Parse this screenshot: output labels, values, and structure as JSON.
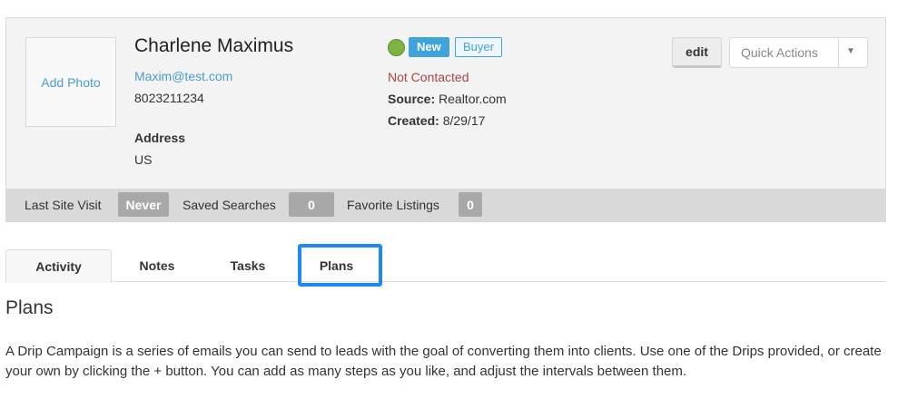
{
  "contact": {
    "photo_label": "Add Photo",
    "name": "Charlene Maximus",
    "email": "Maxim@test.com",
    "phone": "8023211234",
    "address_label": "Address",
    "address_value": "US",
    "badge_new": "New",
    "badge_buyer": "Buyer",
    "status": "Not Contacted",
    "source_label": "Source:",
    "source_value": "Realtor.com",
    "created_label": "Created:",
    "created_value": "8/29/17",
    "status_dot_icon": "green-status-dot-icon"
  },
  "actions": {
    "edit_label": "edit",
    "quick_actions_label": "Quick Actions",
    "caret_icon": "chevron-down-icon"
  },
  "stats": [
    {
      "label": "Last Site Visit",
      "value": "Never"
    },
    {
      "label": "Saved Searches",
      "value": "0"
    },
    {
      "label": "Favorite Listings",
      "value": "0"
    }
  ],
  "tabs": [
    {
      "label": "Activity",
      "active": true
    },
    {
      "label": "Notes",
      "active": false
    },
    {
      "label": "Tasks",
      "active": false
    },
    {
      "label": "Plans",
      "active": false
    }
  ],
  "section": {
    "title": "Plans",
    "description": "A Drip Campaign is a series of emails you can send to leads with the goal of converting them into clients. Use one of the Drips provided, or create your own by clicking the + button. You can add as many steps as you like, and adjust the intervals between them."
  },
  "colors": {
    "accent": "#3fa3dc",
    "highlight": "#1e88f5",
    "status_red": "#a94442",
    "dot_green": "#7cb342"
  }
}
